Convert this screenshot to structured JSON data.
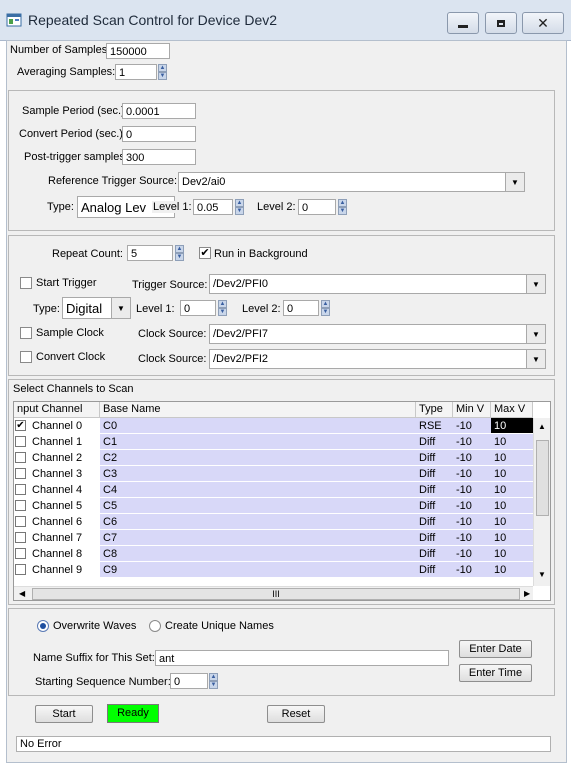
{
  "window": {
    "title": "Repeated Scan Control for Device Dev2",
    "icon": "app-window-icon",
    "controls": [
      "minimize-icon",
      "maximize-icon",
      "close-icon"
    ]
  },
  "sampling": {
    "num_samples_label": "Number of Samples",
    "num_samples_value": "150000",
    "averaging_label": "Averaging Samples:",
    "averaging_value": "1"
  },
  "timing": {
    "sample_period_label": "Sample Period (sec.)",
    "sample_period_value": "0.0001",
    "convert_period_label": "Convert Period (sec.)",
    "convert_period_value": "0",
    "post_trigger_label": "Post-trigger samples",
    "post_trigger_value": "300",
    "ref_trigger_label": "Reference Trigger Source:",
    "ref_trigger_value": "Dev2/ai0",
    "type_label": "Type:",
    "type_value": "Analog Lev",
    "level1_label": "Level 1:",
    "level1_value": "0.05",
    "level2_label": "Level 2:",
    "level2_value": "0"
  },
  "repeat": {
    "repeat_count_label": "Repeat Count:",
    "repeat_count_value": "5",
    "run_background_label": "Run in Background",
    "run_background_checked": true,
    "start_trigger_label": "Start Trigger",
    "trigger_source_label": "Trigger Source:",
    "trigger_source_value": "/Dev2/PFI0",
    "type_label": "Type:",
    "type_value": "Digital",
    "level1_label": "Level 1:",
    "level1_value": "0",
    "level2_label": "Level 2:",
    "level2_value": "0",
    "sample_clock_label": "Sample Clock",
    "clock_source_label": "Clock Source:",
    "clock_source_value": "/Dev2/PFI7",
    "convert_clock_label": "Convert Clock",
    "convert_clock_source_label": "Clock Source:",
    "convert_clock_source_value": "/Dev2/PFI2"
  },
  "channels": {
    "section_label": "Select Channels to Scan",
    "columns": [
      "nput Channel",
      "Base Name",
      "Type",
      "Min V",
      "Max V"
    ],
    "rows": [
      {
        "channel": "Channel 0",
        "base": "C0",
        "type": "RSE",
        "min": "-10",
        "max": "10",
        "checked": true
      },
      {
        "channel": "Channel 1",
        "base": "C1",
        "type": "Diff",
        "min": "-10",
        "max": "10",
        "checked": false
      },
      {
        "channel": "Channel 2",
        "base": "C2",
        "type": "Diff",
        "min": "-10",
        "max": "10",
        "checked": false
      },
      {
        "channel": "Channel 3",
        "base": "C3",
        "type": "Diff",
        "min": "-10",
        "max": "10",
        "checked": false
      },
      {
        "channel": "Channel 4",
        "base": "C4",
        "type": "Diff",
        "min": "-10",
        "max": "10",
        "checked": false
      },
      {
        "channel": "Channel 5",
        "base": "C5",
        "type": "Diff",
        "min": "-10",
        "max": "10",
        "checked": false
      },
      {
        "channel": "Channel 6",
        "base": "C6",
        "type": "Diff",
        "min": "-10",
        "max": "10",
        "checked": false
      },
      {
        "channel": "Channel 7",
        "base": "C7",
        "type": "Diff",
        "min": "-10",
        "max": "10",
        "checked": false
      },
      {
        "channel": "Channel 8",
        "base": "C8",
        "type": "Diff",
        "min": "-10",
        "max": "10",
        "checked": false
      },
      {
        "channel": "Channel 9",
        "base": "C9",
        "type": "Diff",
        "min": "-10",
        "max": "10",
        "checked": false
      }
    ],
    "selected_cell_value": "10",
    "hscroll_grip": "III"
  },
  "naming": {
    "overwrite_label": "Overwrite Waves",
    "unique_label": "Create Unique Names",
    "selected": "overwrite",
    "suffix_label": "Name Suffix for This Set:",
    "suffix_value": "ant",
    "seq_label": "Starting Sequence Number:",
    "seq_value": "0",
    "enter_date": "Enter Date",
    "enter_time": "Enter Time"
  },
  "actions": {
    "start": "Start",
    "status": "Ready",
    "status_color": "#00ff00",
    "reset": "Reset"
  },
  "statusbar": {
    "message": "No Error"
  }
}
